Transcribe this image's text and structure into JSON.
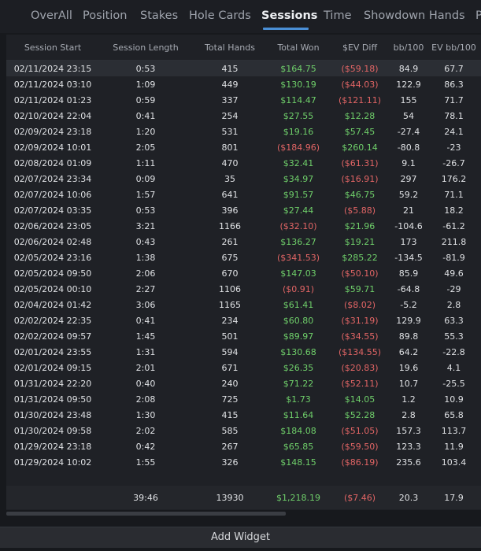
{
  "tabs": [
    {
      "label": "OverAll"
    },
    {
      "label": "Position"
    },
    {
      "label": "Stakes"
    },
    {
      "label": "Hole Cards"
    },
    {
      "label": "Sessions"
    },
    {
      "label": "Time"
    },
    {
      "label": "Showdown Hands"
    },
    {
      "label": "P"
    }
  ],
  "active_tab": "Sessions",
  "table": {
    "columns": [
      "Session Start",
      "Session Length",
      "Total Hands",
      "Total Won",
      "$EV Diff",
      "bb/100",
      "EV bb/100"
    ],
    "rows": [
      [
        "02/11/2024 23:15",
        "0:53",
        "415",
        "$164.75",
        "($59.18)",
        "84.9",
        "67.7"
      ],
      [
        "02/11/2024 03:10",
        "1:09",
        "449",
        "$130.19",
        "($44.03)",
        "122.9",
        "86.3"
      ],
      [
        "02/11/2024 01:23",
        "0:59",
        "337",
        "$114.47",
        "($121.11)",
        "155",
        "71.7"
      ],
      [
        "02/10/2024 22:04",
        "0:41",
        "254",
        "$27.55",
        "$12.28",
        "54",
        "78.1"
      ],
      [
        "02/09/2024 23:18",
        "1:20",
        "531",
        "$19.16",
        "$57.45",
        "-27.4",
        "24.1"
      ],
      [
        "02/09/2024 10:01",
        "2:05",
        "801",
        "($184.96)",
        "$260.14",
        "-80.8",
        "-23"
      ],
      [
        "02/08/2024 01:09",
        "1:11",
        "470",
        "$32.41",
        "($61.31)",
        "9.1",
        "-26.7"
      ],
      [
        "02/07/2024 23:34",
        "0:09",
        "35",
        "$34.97",
        "($16.91)",
        "297",
        "176.2"
      ],
      [
        "02/07/2024 10:06",
        "1:57",
        "641",
        "$91.57",
        "$46.75",
        "59.2",
        "71.1"
      ],
      [
        "02/07/2024 03:35",
        "0:53",
        "396",
        "$27.44",
        "($5.88)",
        "21",
        "18.2"
      ],
      [
        "02/06/2024 23:05",
        "3:21",
        "1166",
        "($32.10)",
        "$21.96",
        "-104.6",
        "-61.2"
      ],
      [
        "02/06/2024 02:48",
        "0:43",
        "261",
        "$136.27",
        "$19.21",
        "173",
        "211.8"
      ],
      [
        "02/05/2024 23:16",
        "1:38",
        "675",
        "($341.53)",
        "$285.22",
        "-134.5",
        "-81.9"
      ],
      [
        "02/05/2024 09:50",
        "2:06",
        "670",
        "$147.03",
        "($50.10)",
        "85.9",
        "49.6"
      ],
      [
        "02/05/2024 00:10",
        "2:27",
        "1106",
        "($0.91)",
        "$59.71",
        "-64.8",
        "-29"
      ],
      [
        "02/04/2024 01:42",
        "3:06",
        "1165",
        "$61.41",
        "($8.02)",
        "-5.2",
        "2.8"
      ],
      [
        "02/02/2024 22:35",
        "0:41",
        "234",
        "$60.80",
        "($31.19)",
        "129.9",
        "63.3"
      ],
      [
        "02/02/2024 09:57",
        "1:45",
        "501",
        "$89.97",
        "($34.55)",
        "89.8",
        "55.3"
      ],
      [
        "02/01/2024 23:55",
        "1:31",
        "594",
        "$130.68",
        "($134.55)",
        "64.2",
        "-22.8"
      ],
      [
        "02/01/2024 09:15",
        "2:01",
        "671",
        "$26.35",
        "($20.83)",
        "19.6",
        "4.1"
      ],
      [
        "01/31/2024 22:20",
        "0:40",
        "240",
        "$71.22",
        "($52.11)",
        "10.7",
        "-25.5"
      ],
      [
        "01/31/2024 09:50",
        "2:08",
        "725",
        "$1.73",
        "$14.05",
        "1.2",
        "10.9"
      ],
      [
        "01/30/2024 23:48",
        "1:30",
        "415",
        "$11.64",
        "$52.28",
        "2.8",
        "65.8"
      ],
      [
        "01/30/2024 09:58",
        "2:02",
        "585",
        "$184.08",
        "($51.05)",
        "157.3",
        "113.7"
      ],
      [
        "01/29/2024 23:18",
        "0:42",
        "267",
        "$65.85",
        "($59.50)",
        "123.3",
        "11.9"
      ],
      [
        "01/29/2024 10:02",
        "1:55",
        "326",
        "$148.15",
        "($86.19)",
        "235.6",
        "103.4"
      ]
    ],
    "totals": [
      "",
      "39:46",
      "13930",
      "$1,218.19",
      "($7.46)",
      "20.3",
      "17.9"
    ]
  },
  "colors": {
    "positive": "#6fcf6a",
    "negative": "#e26565",
    "accent": "#4a8fd6"
  },
  "footer": {
    "add_widget_label": "Add Widget"
  }
}
